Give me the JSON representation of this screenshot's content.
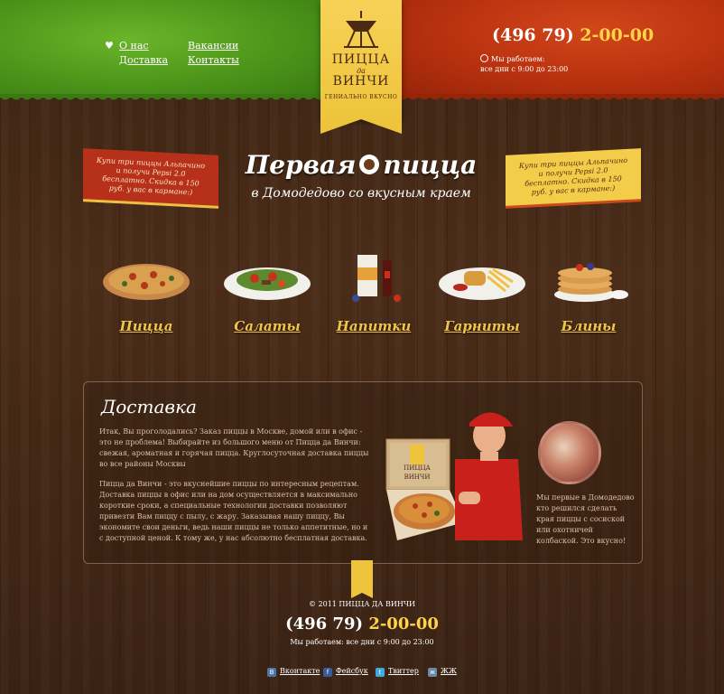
{
  "header": {
    "nav": {
      "about": "О нас",
      "delivery": "Доставка",
      "vacancies": "Вакансии",
      "contacts": "Контакты"
    },
    "logo": {
      "line1": "ПИЦЦА",
      "line2": "да",
      "line3": "ВИНЧИ",
      "tagline": "ГЕНИАЛЬНО ВКУСНО"
    },
    "phone_code": "(496 79)",
    "phone_number": "2-00-00",
    "hours_label": "Мы работаем:",
    "hours_value": "все дни с 9:00 до 23:00"
  },
  "hero": {
    "title_part1": "Первая",
    "title_part2": "пицца",
    "subtitle": "в Домодедово со вкусным краем",
    "promo_left": "Купи три пиццы Альпачино и получи Pepsi 2.0 бесплатно. Скидка в 150 руб. у вас в кармане:)",
    "promo_right": "Купи три пиццы Альпачино и получи Pepsi 2.0 бесплатно. Скидка в 150 руб. у вас в кармане:)"
  },
  "categories": [
    {
      "label": "Пицца"
    },
    {
      "label": "Салаты"
    },
    {
      "label": "Напитки"
    },
    {
      "label": "Гарниты"
    },
    {
      "label": "Блины"
    }
  ],
  "delivery": {
    "title": "Доставка",
    "para1": "Итак, Вы проголодались? Заказ пиццы в Москве, домой или в офис - это не проблема! Выбирайте из большого меню от Пицца да Винчи: свежая, ароматная и горячая пицца. Круглосуточная доставка пиццы во все районы Москвы",
    "para2": "Пицца да Винчи - это вкуснейшие пиццы по интересным рецептам. Доставка пиццы в офис или на дом осуществляется в максимально короткие сроки, а специальные технологии доставки позволяют привезти Вам пиццу с пылу, с жару. Заказывая нашу пиццу, Вы экономите свои деньги, ведь наши пиццы не только аппетитные, но и с доступной ценой. К тому же, у нас абсолютно бесплатная доставка.",
    "side_text": "Мы первые в Домодедово кто решился сделать края пиццы с сосиской или охотничей колбаской. Это вкусно!",
    "box_logo_line1": "ПИЦЦА",
    "box_logo_line2": "ВИНЧИ"
  },
  "footer": {
    "copyright": "© 2011 ПИЦЦА ДА ВИНЧИ",
    "phone_code": "(496 79)",
    "phone_number": "2-00-00",
    "hours": "Мы работаем: все дни с 9:00 до 23:00",
    "social": [
      {
        "label": "Вконтакте",
        "icon": "В",
        "color": "#4a76a8"
      },
      {
        "label": "Фейсбук",
        "icon": "f",
        "color": "#3b5998"
      },
      {
        "label": "Твиттер",
        "icon": "t",
        "color": "#3fa9e0"
      },
      {
        "label": "ЖЖ",
        "icon": "ж",
        "color": "#6a8aa8"
      }
    ]
  }
}
